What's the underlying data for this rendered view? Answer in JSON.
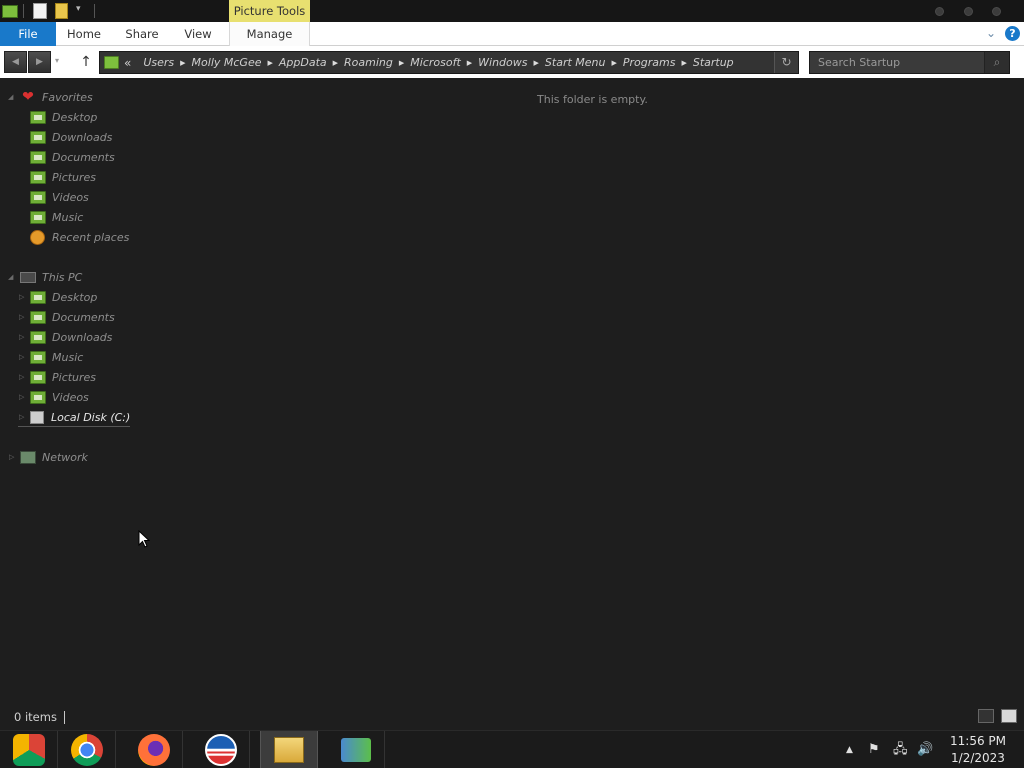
{
  "titlebar": {
    "contextual_tab": "Picture Tools"
  },
  "ribbon": {
    "tabs": [
      {
        "label": "File"
      },
      {
        "label": "Home"
      },
      {
        "label": "Share"
      },
      {
        "label": "View"
      },
      {
        "label": "Manage"
      }
    ],
    "help": "?"
  },
  "address": {
    "overflow": "«",
    "crumbs": [
      "Users",
      "Molly McGee",
      "AppData",
      "Roaming",
      "Microsoft",
      "Windows",
      "Start Menu",
      "Programs",
      "Startup"
    ]
  },
  "search": {
    "placeholder": "Search Startup"
  },
  "nav": {
    "favorites": {
      "label": "Favorites",
      "items": [
        "Desktop",
        "Downloads",
        "Documents",
        "Pictures",
        "Videos",
        "Music",
        "Recent places"
      ]
    },
    "this_pc": {
      "label": "This PC",
      "items": [
        "Desktop",
        "Documents",
        "Downloads",
        "Music",
        "Pictures",
        "Videos",
        "Local Disk (C:)"
      ]
    },
    "network": {
      "label": "Network"
    }
  },
  "content": {
    "empty_message": "This folder is empty."
  },
  "status": {
    "item_count": "0 items"
  },
  "taskbar": {
    "apps": [
      "chrome-os-app-icon",
      "chrome-icon",
      "firefox-icon",
      "obama-logo-icon",
      "file-explorer-icon",
      "network-people-icon"
    ],
    "clock_time": "11:56 PM",
    "clock_date": "1/2/2023"
  },
  "colors": {
    "file_tab": "#1979ca",
    "contextual_tab": "#e8e070",
    "folder_green": "#6fae37",
    "background": "#1e1e1e"
  }
}
